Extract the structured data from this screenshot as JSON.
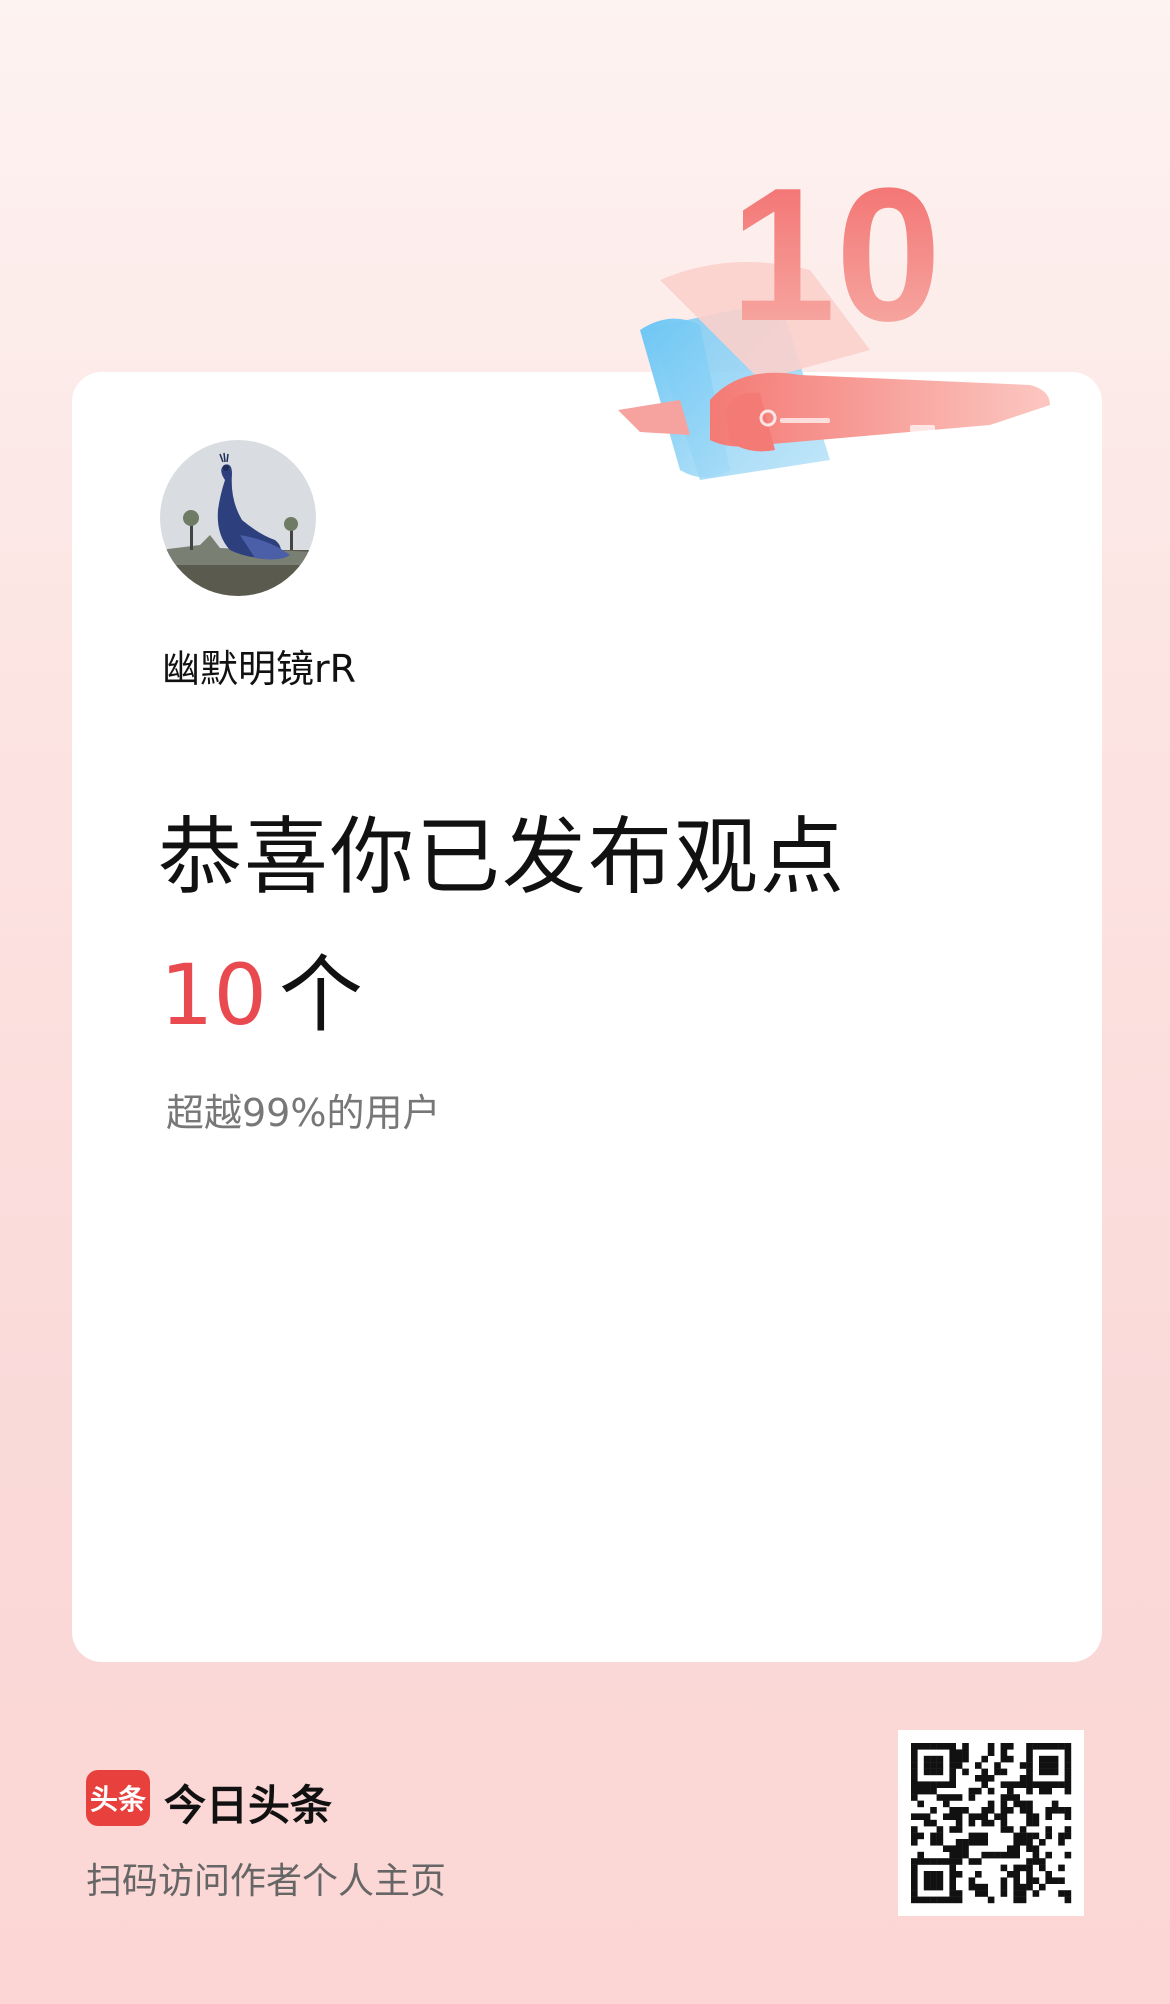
{
  "badge": {
    "number": "10"
  },
  "user": {
    "name": "幽默明镜rR"
  },
  "achievement": {
    "headline": "恭喜你已发布观点",
    "count": "10",
    "unit": "个",
    "subtitle": "超越99%的用户"
  },
  "footer": {
    "logo_text": "头条",
    "brand": "今日头条",
    "cta": "扫码访问作者个人主页"
  },
  "colors": {
    "accent": "#e94a4f",
    "logo_red": "#e8403d",
    "ribbon_blue": "#5ab8ef"
  },
  "icons": [
    "avatar-peacock",
    "qr-code-icon",
    "scroll-ribbon-icon"
  ]
}
